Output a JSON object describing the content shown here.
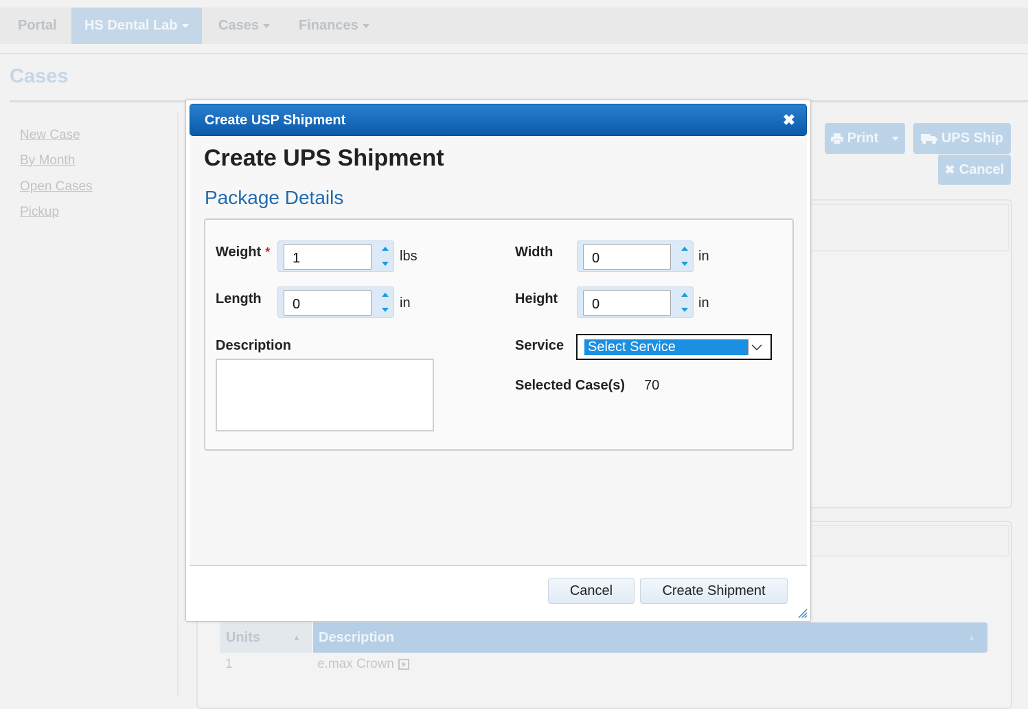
{
  "nav": {
    "items": [
      {
        "label": "Portal",
        "active": false,
        "dropdown": false
      },
      {
        "label": "HS Dental Lab",
        "active": true,
        "dropdown": true
      },
      {
        "label": "Cases",
        "active": false,
        "dropdown": true
      },
      {
        "label": "Finances",
        "active": false,
        "dropdown": true
      }
    ]
  },
  "page": {
    "title": "Cases",
    "sidebar": [
      "New Case",
      "By Month",
      "Open Cases",
      "Pickup"
    ],
    "toolbar": {
      "print": "Print",
      "ups_ship": "UPS Ship",
      "cancel": "Cancel"
    },
    "grid": {
      "headers": [
        "Units",
        "Description"
      ],
      "rows": [
        {
          "units": "1",
          "description": "e.max Crown"
        }
      ]
    }
  },
  "dialog": {
    "title": "Create USP Shipment",
    "heading": "Create UPS Shipment",
    "section": "Package Details",
    "fields": {
      "weight": {
        "label": "Weight",
        "value": "1",
        "unit": "lbs",
        "required": true
      },
      "length": {
        "label": "Length",
        "value": "0",
        "unit": "in"
      },
      "width": {
        "label": "Width",
        "value": "0",
        "unit": "in"
      },
      "height": {
        "label": "Height",
        "value": "0",
        "unit": "in"
      },
      "description": {
        "label": "Description",
        "value": ""
      },
      "service": {
        "label": "Service",
        "selected": "Select Service"
      },
      "selected_cases": {
        "label": "Selected Case(s)",
        "value": "70"
      }
    },
    "buttons": {
      "cancel": "Cancel",
      "create": "Create Shipment"
    }
  },
  "colors": {
    "header_blue": "#0a5aa9",
    "link_blue": "#1f6bb0",
    "required_red": "#d81919",
    "select_blue": "#1b8fe1"
  }
}
